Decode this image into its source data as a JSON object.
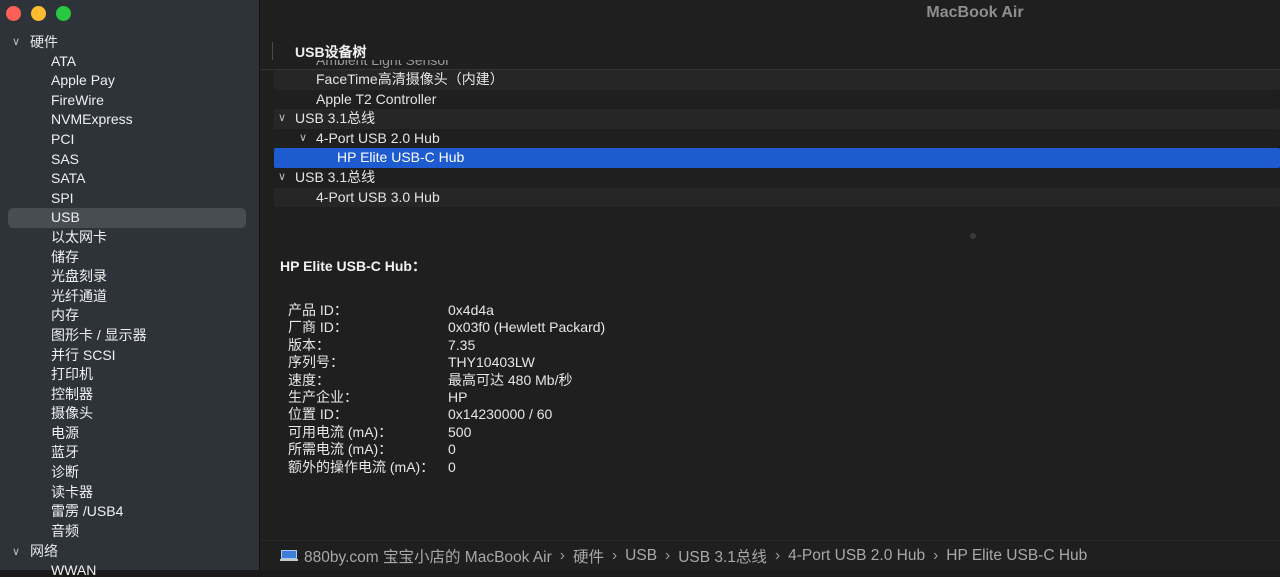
{
  "window_title": "MacBook Air",
  "sidebar": {
    "groups": [
      {
        "label": "硬件",
        "items": [
          "ATA",
          "Apple Pay",
          "FireWire",
          "NVMExpress",
          "PCI",
          "SAS",
          "SATA",
          "SPI",
          "USB",
          "以太网卡",
          "储存",
          "光盘刻录",
          "光纤通道",
          "内存",
          "图形卡 / 显示器",
          "并行 SCSI",
          "打印机",
          "控制器",
          "摄像头",
          "电源",
          "蓝牙",
          "诊断",
          "读卡器",
          "雷雳 /USB4",
          "音频"
        ],
        "selected": "USB"
      },
      {
        "label": "网络",
        "items": [
          "WWAN"
        ]
      }
    ]
  },
  "tree": {
    "header": "USB设备树",
    "rows": [
      {
        "label": "Ambient Light Sensor",
        "level": 1,
        "expanded": null
      },
      {
        "label": "FaceTime高清摄像头（内建）",
        "level": 1,
        "expanded": null
      },
      {
        "label": "Apple T2 Controller",
        "level": 1,
        "expanded": null
      },
      {
        "label": "USB 3.1总线",
        "level": 0,
        "expanded": true
      },
      {
        "label": "4-Port USB 2.0 Hub",
        "level": 1,
        "expanded": true
      },
      {
        "label": "HP Elite USB-C Hub",
        "level": 2,
        "expanded": null,
        "selected": true
      },
      {
        "label": "USB 3.1总线",
        "level": 0,
        "expanded": true
      },
      {
        "label": "4-Port USB 3.0 Hub",
        "level": 1,
        "expanded": null
      }
    ]
  },
  "detail": {
    "title": "HP Elite USB-C Hub：",
    "properties": [
      {
        "key": "产品 ID：",
        "value": "0x4d4a"
      },
      {
        "key": "厂商 ID：",
        "value": "0x03f0  (Hewlett Packard)"
      },
      {
        "key": "版本：",
        "value": "7.35"
      },
      {
        "key": "序列号：",
        "value": "THY10403LW"
      },
      {
        "key": "速度：",
        "value": "最高可达 480 Mb/秒"
      },
      {
        "key": "生产企业：",
        "value": "HP"
      },
      {
        "key": "位置 ID：",
        "value": "0x14230000 / 60"
      },
      {
        "key": "可用电流 (mA)：",
        "value": "500"
      },
      {
        "key": "所需电流 (mA)：",
        "value": "0"
      },
      {
        "key": "额外的操作电流 (mA)：",
        "value": "0"
      }
    ]
  },
  "statusbar": {
    "icon": "macbook-icon",
    "breadcrumb": [
      "880by.com 宝宝小店的 MacBook Air",
      "硬件",
      "USB",
      "USB 3.1总线",
      "4-Port USB 2.0 Hub",
      "HP Elite USB-C Hub"
    ],
    "separator": "›"
  },
  "colors": {
    "selection": "#1e5ad0",
    "sidebar_bg": "#2e333a",
    "main_bg": "#1f1f1f"
  }
}
